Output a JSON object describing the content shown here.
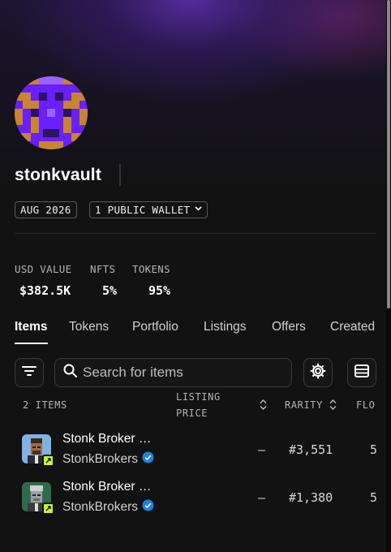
{
  "profile": {
    "username": "stonkvault",
    "joined": "AUG 2026",
    "wallets_label": "1 PUBLIC WALLET"
  },
  "stats": [
    {
      "label": "USD VALUE",
      "value": "$382.5K"
    },
    {
      "label": "NFTS",
      "value": "5%"
    },
    {
      "label": "TOKENS",
      "value": "95%"
    }
  ],
  "tabs": [
    "Items",
    "Tokens",
    "Portfolio",
    "Listings",
    "Offers",
    "Created"
  ],
  "active_tab": "Items",
  "search": {
    "placeholder": "Search for items",
    "value": ""
  },
  "table": {
    "count_label": "2 ITEMS",
    "col_listing_line1": "LISTING",
    "col_listing_line2": "PRICE",
    "col_rarity": "RARITY",
    "col_floor": "FLO"
  },
  "items": [
    {
      "name": "Stonk Broker …",
      "collection": "StonkBrokers",
      "listing_price": "–",
      "rarity": "#3,551",
      "floor": "5"
    },
    {
      "name": "Stonk Broker …",
      "collection": "StonkBrokers",
      "listing_price": "–",
      "rarity": "#1,380",
      "floor": "5"
    }
  ],
  "colors": {
    "background": "#121212",
    "avatar_bg": "#6a1fff",
    "avatar_accent": "#c9852e",
    "badge": "#c6f432",
    "verified": "#2081e2"
  },
  "icons": [
    "filter-icon",
    "search-icon",
    "gear-icon",
    "table-view-icon",
    "sort-icon",
    "verified-icon",
    "chevron-down-icon"
  ]
}
